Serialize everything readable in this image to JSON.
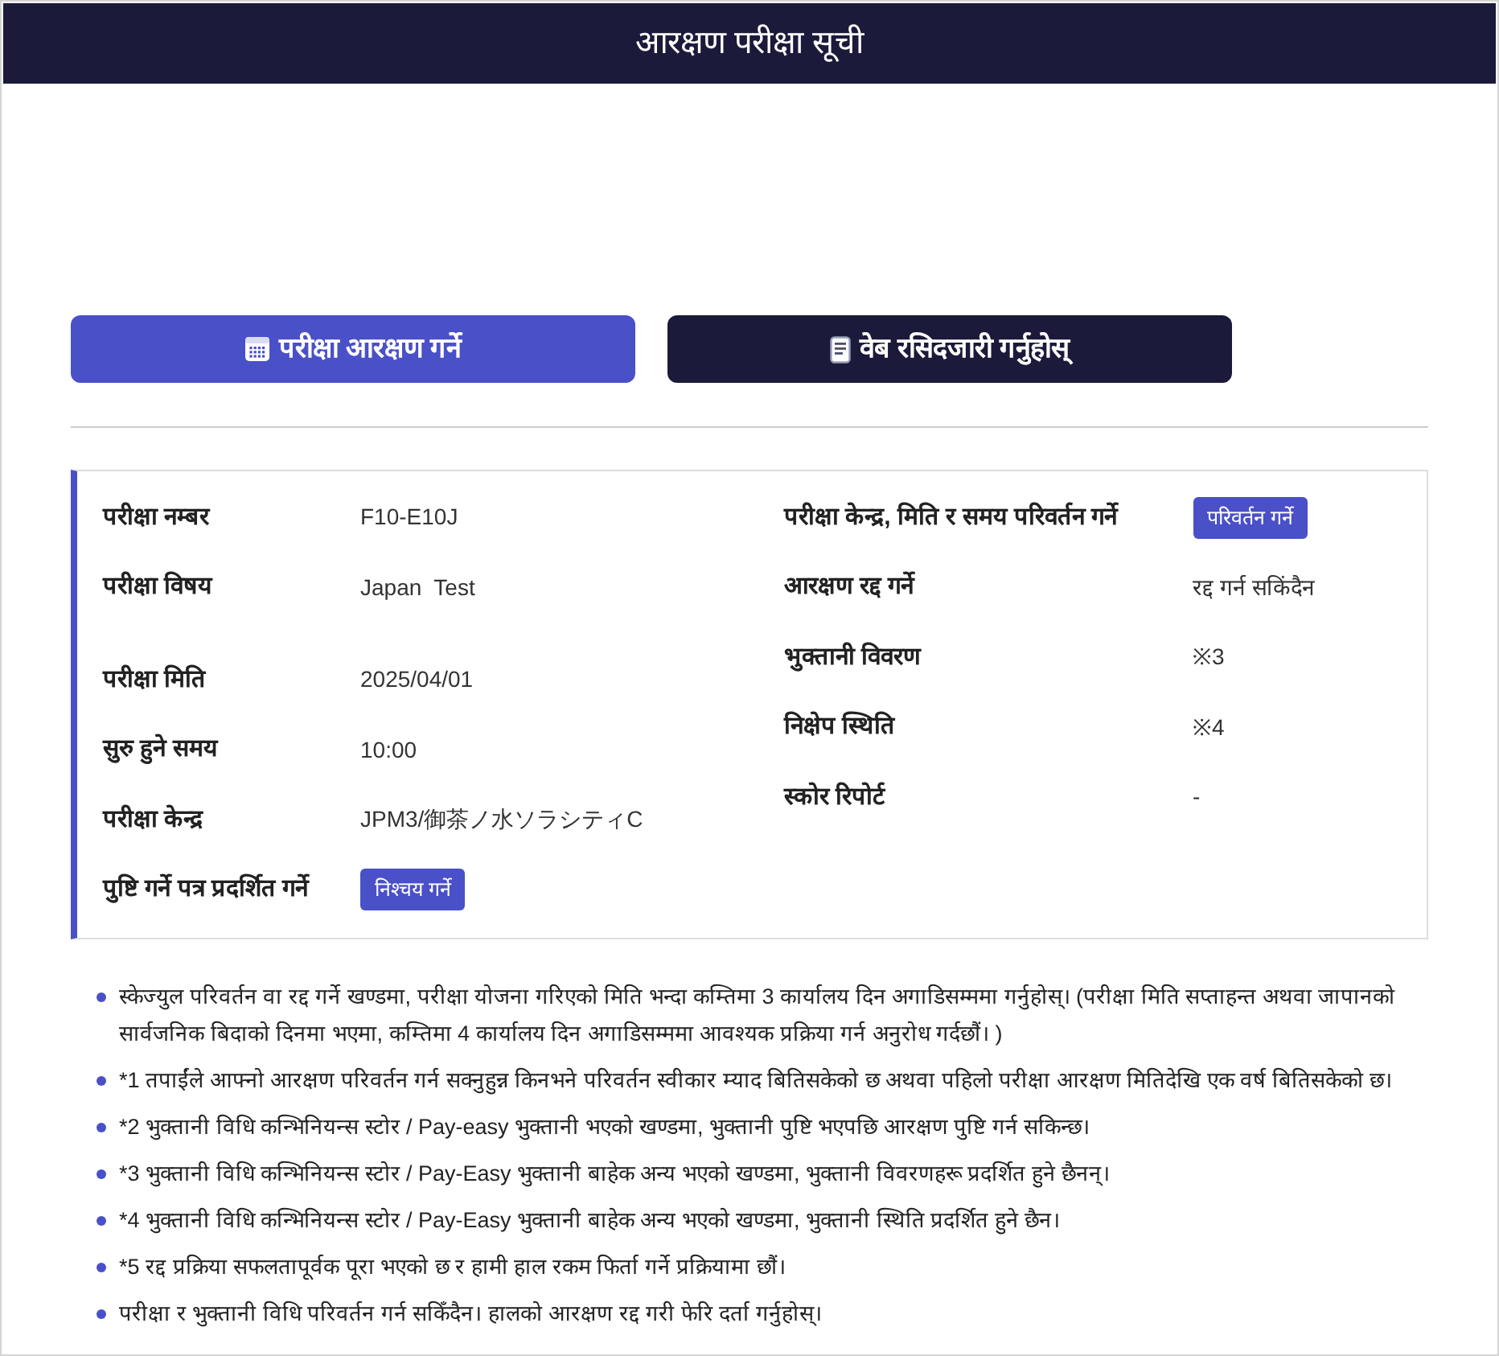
{
  "header": {
    "title": "आरक्षण परीक्षा सूची"
  },
  "actions": [
    {
      "kind": "primary",
      "label": "परीक्षा आरक्षण गर्ने"
    },
    {
      "kind": "dark",
      "label": "वेब रसिदजारी गर्नुहोस्"
    }
  ],
  "details": {
    "left": [
      {
        "kind": "text",
        "label": "परीक्षा नम्बर",
        "value": "F10-E10J"
      },
      {
        "kind": "text",
        "label": "परीक्षा विषय",
        "value": "Japan  Test"
      },
      {
        "kind": "text",
        "label": "परीक्षा मिति",
        "value": "2025/04/01"
      },
      {
        "kind": "text",
        "label": "सुरु हुने समय",
        "value": "10:00"
      },
      {
        "kind": "text",
        "label": "परीक्षा केन्द्र",
        "value": "JPM3/御茶ノ水ソラシティC"
      },
      {
        "kind": "button",
        "label": "पुष्टि गर्ने पत्र प्रदर्शित गर्ने",
        "value": "निश्चय गर्ने"
      }
    ],
    "right": [
      {
        "kind": "button",
        "label": "परीक्षा केन्द्र, मिति र समय परिवर्तन गर्ने",
        "value": "परिवर्तन गर्ने"
      },
      {
        "kind": "text",
        "label": "आरक्षण रद्द गर्ने",
        "value": "रद्द गर्न सकिंदैन"
      },
      {
        "kind": "text",
        "label": "भुक्तानी विवरण",
        "value": "※3"
      },
      {
        "kind": "text",
        "label": "निक्षेप स्थिति",
        "value": "※4"
      },
      {
        "kind": "text",
        "label": "स्कोर रिपोर्ट",
        "value": "-"
      }
    ]
  },
  "notes": [
    "स्केज्युल परिवर्तन वा रद्द गर्ने खण्डमा, परीक्षा योजना गरिएको मिति भन्दा कम्तिमा 3 कार्यालय दिन अगाडिसम्ममा गर्नुहोस्। (परीक्षा मिति सप्ताहन्त अथवा जापानको सार्वजनिक बिदाको दिनमा भएमा, कम्तिमा 4 कार्यालय दिन अगाडिसम्ममा आवश्यक प्रक्रिया गर्न अनुरोध गर्दछौं। )",
    "*1 तपाईंले आफ्नो आरक्षण परिवर्तन गर्न सक्नुहुन्न किनभने परिवर्तन स्वीकार म्याद बितिसकेको छ अथवा पहिलो परीक्षा आरक्षण मितिदेखि एक वर्ष बितिसकेको छ।",
    "*2 भुक्तानी विधि कन्भिनियन्स स्टोर / Pay-easy भुक्तानी भएको खण्डमा, भुक्तानी पुष्टि भएपछि आरक्षण पुष्टि गर्न सकिन्छ।",
    "*3 भुक्तानी विधि कन्भिनियन्स स्टोर / Pay-Easy भुक्तानी बाहेक अन्य भएको खण्डमा, भुक्तानी विवरणहरू प्रदर्शित हुने छैनन्।",
    "*4 भुक्तानी विधि कन्भिनियन्स स्टोर / Pay-Easy भुक्तानी बाहेक अन्य भएको खण्डमा, भुक्तानी स्थिति प्रदर्शित हुने छैन।",
    "*5 रद्द प्रक्रिया सफलतापूर्वक पूरा भएको छ र हामी हाल रकम फिर्ता गर्ने प्रक्रियामा छौं।",
    "परीक्षा र भुक्तानी विधि परिवर्तन गर्न सकिँदैन। हालको आरक्षण रद्द गरी फेरि दर्ता गर्नुहोस्।"
  ]
}
